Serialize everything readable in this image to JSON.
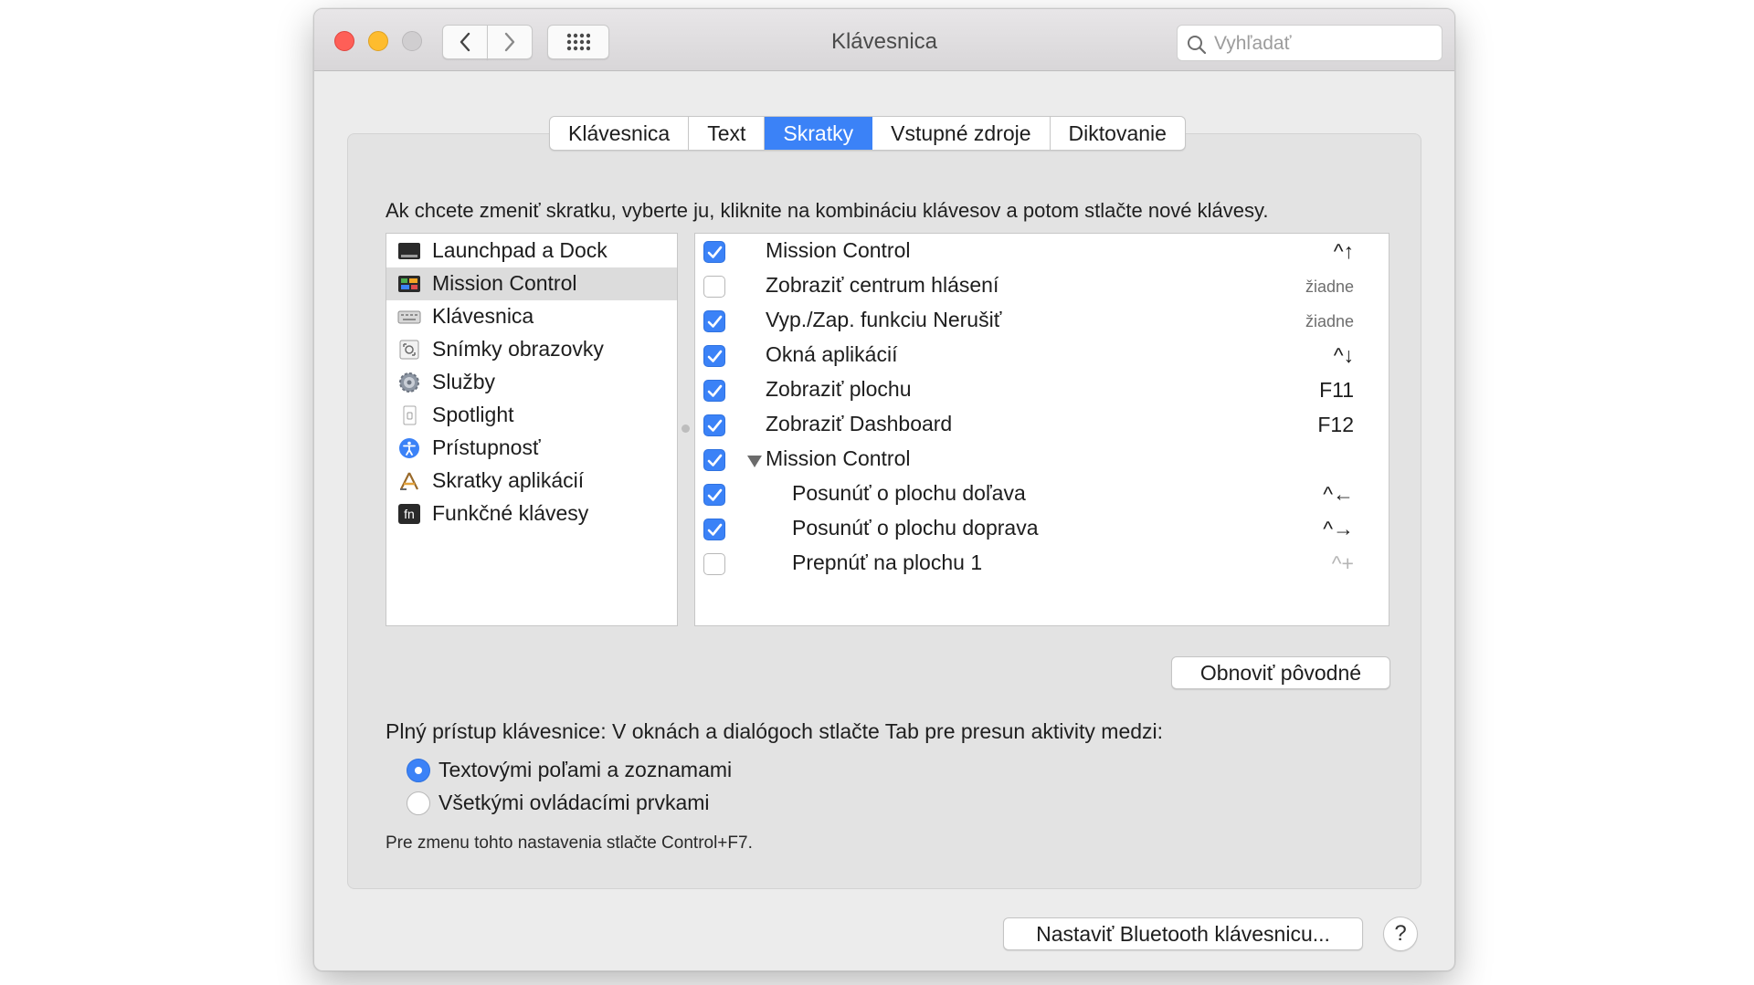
{
  "window": {
    "title": "Klávesnica",
    "search_placeholder": "Vyhľadať"
  },
  "tabs": [
    {
      "label": "Klávesnica",
      "active": false
    },
    {
      "label": "Text",
      "active": false
    },
    {
      "label": "Skratky",
      "active": true
    },
    {
      "label": "Vstupné zdroje",
      "active": false
    },
    {
      "label": "Diktovanie",
      "active": false
    }
  ],
  "instruction": "Ak chcete zmeniť skratku, vyberte ju, kliknite na kombináciu klávesov a potom stlačte nové klávesy.",
  "categories": [
    {
      "label": "Launchpad a Dock",
      "icon": "launchpad-dock-icon",
      "selected": false
    },
    {
      "label": "Mission Control",
      "icon": "mission-control-icon",
      "selected": true
    },
    {
      "label": "Klávesnica",
      "icon": "keyboard-icon",
      "selected": false
    },
    {
      "label": "Snímky obrazovky",
      "icon": "screenshot-icon",
      "selected": false
    },
    {
      "label": "Služby",
      "icon": "gear-icon",
      "selected": false
    },
    {
      "label": "Spotlight",
      "icon": "spotlight-icon",
      "selected": false
    },
    {
      "label": "Prístupnosť",
      "icon": "accessibility-icon",
      "selected": false
    },
    {
      "label": "Skratky aplikácií",
      "icon": "app-shortcuts-icon",
      "selected": false
    },
    {
      "label": "Funkčné klávesy",
      "icon": "fn-key-icon",
      "selected": false
    }
  ],
  "shortcuts": [
    {
      "label": "Mission Control",
      "key": "^↑",
      "checked": true,
      "indent": 0,
      "key_style": "normal"
    },
    {
      "label": "Zobraziť centrum hlásení",
      "key": "žiadne",
      "checked": false,
      "indent": 0,
      "key_style": "none"
    },
    {
      "label": "Vyp./Zap. funkciu Nerušiť",
      "key": "žiadne",
      "checked": true,
      "indent": 0,
      "key_style": "none"
    },
    {
      "label": "Okná aplikácií",
      "key": "^↓",
      "checked": true,
      "indent": 0,
      "key_style": "normal"
    },
    {
      "label": "Zobraziť plochu",
      "key": "F11",
      "checked": true,
      "indent": 0,
      "key_style": "normal"
    },
    {
      "label": "Zobraziť Dashboard",
      "key": "F12",
      "checked": true,
      "indent": 0,
      "key_style": "normal"
    },
    {
      "label": "Mission Control",
      "key": "",
      "checked": true,
      "indent": 0,
      "key_style": "normal",
      "group": true
    },
    {
      "label": "Posunúť o plochu doľava",
      "key": "^←",
      "checked": true,
      "indent": 1,
      "key_style": "normal"
    },
    {
      "label": "Posunúť o plochu doprava",
      "key": "^→",
      "checked": true,
      "indent": 1,
      "key_style": "normal"
    },
    {
      "label": "Prepnúť na plochu 1",
      "key": "^+",
      "checked": false,
      "indent": 1,
      "key_style": "dim"
    }
  ],
  "restore_button": "Obnoviť pôvodné",
  "full_keyboard_access": {
    "label": "Plný prístup klávesnice: V oknách a dialógoch stlačte Tab pre presun aktivity medzi:",
    "options": [
      {
        "label": "Textovými poľami a zoznamami",
        "selected": true
      },
      {
        "label": "Všetkými ovládacími prvkami",
        "selected": false
      }
    ],
    "note": "Pre zmenu tohto nastavenia stlačte Control+F7."
  },
  "bluetooth_button": "Nastaviť Bluetooth klávesnicu...",
  "help_button": "?",
  "colors": {
    "accent": "#3b82f7"
  }
}
